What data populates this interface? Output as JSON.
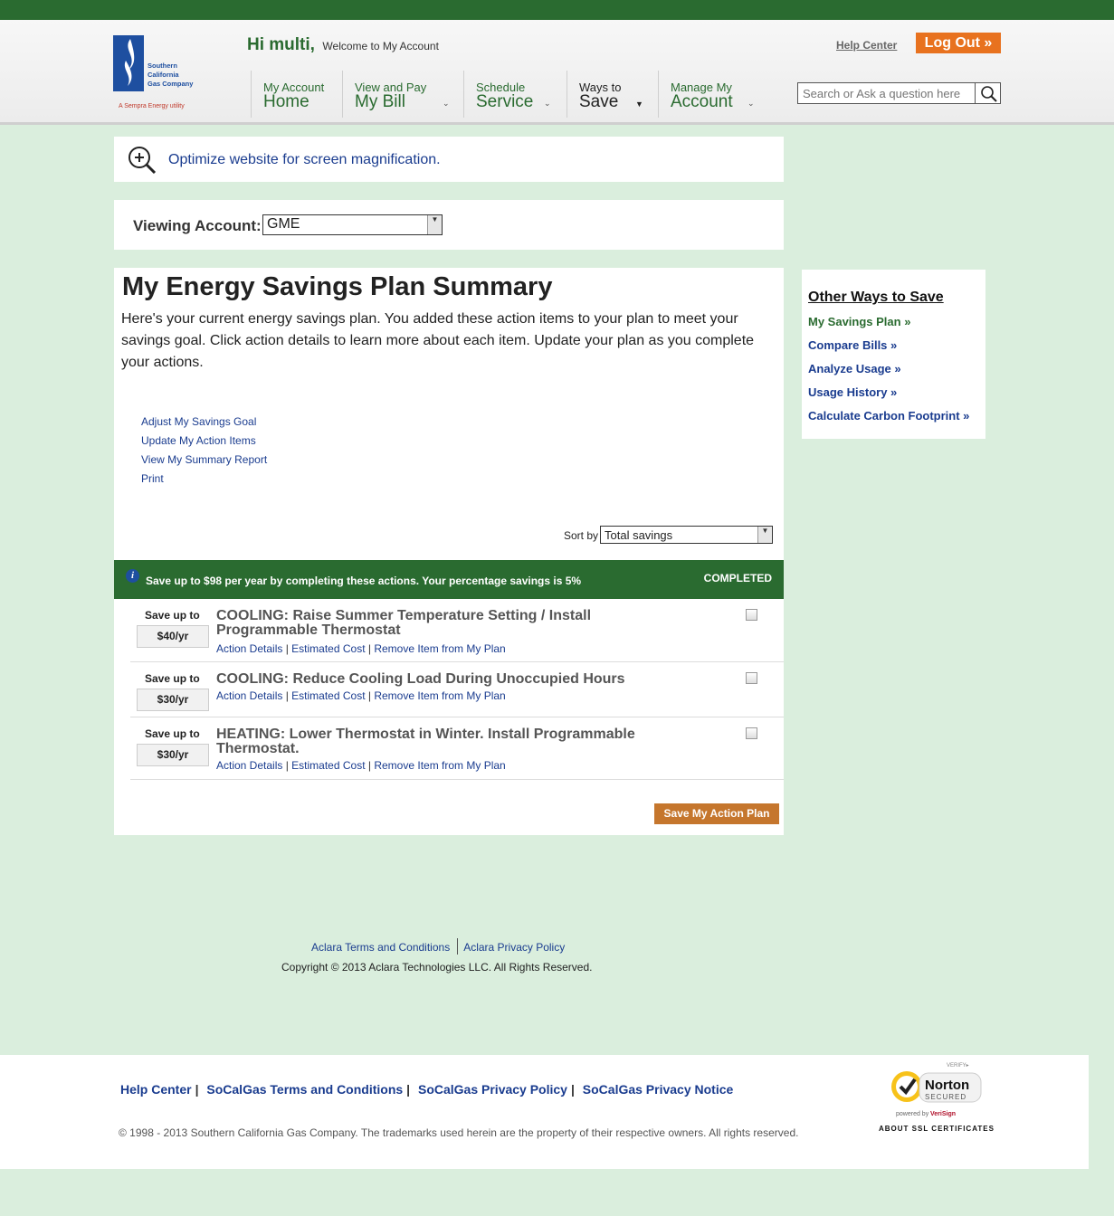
{
  "header": {
    "logo_text_lines": [
      "Southern",
      "California",
      "Gas Company"
    ],
    "logo_sempra": "A Sempra Energy utility",
    "greeting": "Hi multi,",
    "welcome": "Welcome to My Account",
    "help_center": "Help Center",
    "logout": "Log Out »",
    "search_placeholder": "Search or Ask a question here",
    "nav": [
      {
        "small": "My Account",
        "big": "Home"
      },
      {
        "small": "View and Pay",
        "big": "My Bill"
      },
      {
        "small": "Schedule",
        "big": "Service"
      },
      {
        "small": "Ways to",
        "big": "Save"
      },
      {
        "small": "Manage My",
        "big": "Account"
      }
    ]
  },
  "magnify": {
    "link": "Optimize website for screen magnification."
  },
  "viewing": {
    "label": "Viewing Account:",
    "selected": "GME"
  },
  "main": {
    "title": "My Energy Savings Plan Summary",
    "intro": "Here's your current energy savings plan. You added these action items to your plan to meet your savings goal. Click action details to learn more about each item. Update your plan as you complete your actions.",
    "links": [
      "Adjust My Savings Goal",
      "Update My Action Items",
      "View My Summary Report",
      "Print"
    ],
    "sort_label": "Sort by",
    "sort_selected": "Total savings",
    "banner_msg": "Save up to $98 per year by completing these actions. Your percentage savings is 5%",
    "banner_completed": "COMPLETED",
    "save_up_to": "Save up to",
    "action_details": "Action Details",
    "estimated_cost": "Estimated Cost",
    "remove_item": "Remove Item from My Plan",
    "items": [
      {
        "amount": "$40/yr",
        "title": "COOLING: Raise Summer Temperature Setting / Install Programmable Thermostat",
        "checked": false
      },
      {
        "amount": "$30/yr",
        "title": "COOLING: Reduce Cooling Load During Unoccupied Hours",
        "checked": false
      },
      {
        "amount": "$30/yr",
        "title": "HEATING: Lower Thermostat in Winter. Install Programmable Thermostat.",
        "checked": false
      }
    ],
    "save_button": "Save My Action Plan"
  },
  "sidebar": {
    "title": "Other Ways to Save",
    "links": [
      "My Savings Plan »",
      "Compare Bills »",
      "Analyze Usage »",
      "Usage History »",
      "Calculate Carbon Footprint »"
    ]
  },
  "aclara": {
    "terms": "Aclara Terms and Conditions",
    "privacy": "Aclara Privacy Policy",
    "copyright": "Copyright © 2013 Aclara Technologies LLC. All Rights Reserved."
  },
  "footer": {
    "links": [
      "Help Center",
      "SoCalGas Terms and Conditions",
      "SoCalGas Privacy Policy",
      "SoCalGas Privacy Notice"
    ],
    "copyright": "© 1998 - 2013 Southern California Gas Company. The trademarks used herein are the property of their respective owners. All rights reserved.",
    "norton_verify": "VERIFY▸",
    "norton_name": "Norton",
    "norton_secured": "SECURED",
    "norton_powered": "powered by",
    "norton_verisign": "VeriSign",
    "norton_about": "ABOUT SSL CERTIFICATES"
  },
  "colors": {
    "brand_green": "#2a6b30",
    "accent_orange": "#e8721f",
    "page_bg": "#daeedd",
    "link_blue": "#1a3c8f"
  }
}
